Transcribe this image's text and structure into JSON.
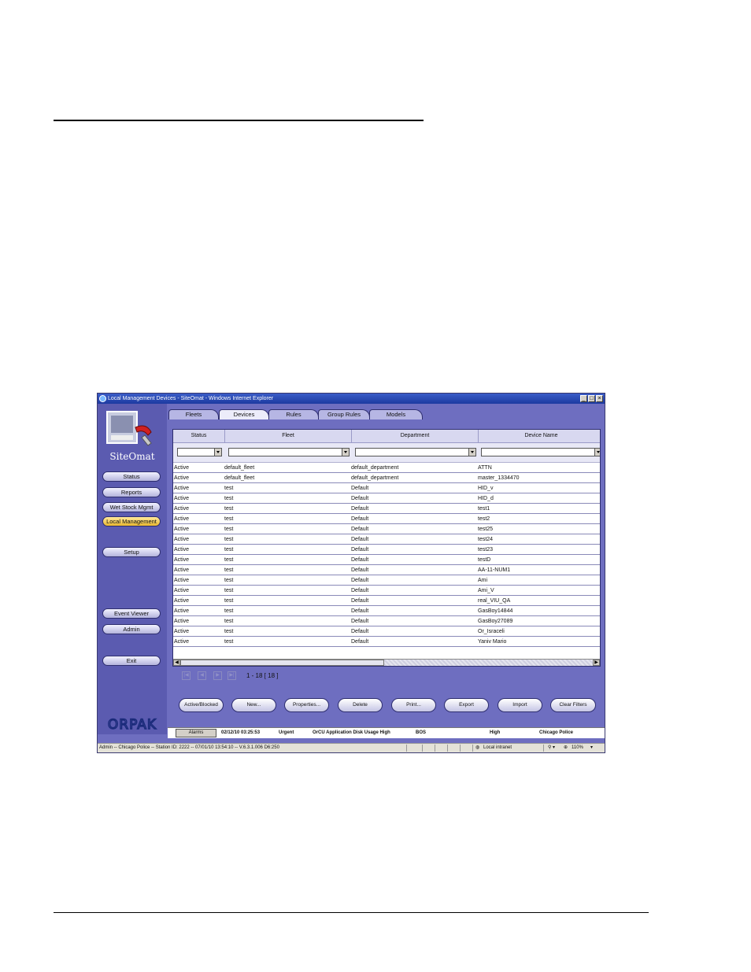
{
  "window": {
    "title": "Local Management Devices - SiteOmat - Windows Internet Explorer",
    "minimize": "_",
    "maximize": "□",
    "close": "×"
  },
  "sidebar": {
    "logo_text": "SiteOmat",
    "buttons": {
      "status": "Status",
      "reports": "Reports",
      "wet_stock": "Wet Stock Mgmt",
      "local_management": "Local Management",
      "setup": "Setup",
      "event_viewer": "Event Viewer",
      "admin": "Admin",
      "exit": "Exit"
    },
    "brand": "ORPAK"
  },
  "tabs": {
    "fleets": "Fleets",
    "devices": "Devices",
    "rules": "Rules",
    "group_rules": "Group Rules",
    "models": "Models"
  },
  "table": {
    "columns": [
      "Status",
      "Fleet",
      "Department",
      "Device Name"
    ],
    "rows": [
      [
        "Active",
        "default_fleet",
        "default_department",
        "ATTN"
      ],
      [
        "Active",
        "default_fleet",
        "default_department",
        "master_1334470"
      ],
      [
        "Active",
        "test",
        "Default",
        "HID_v"
      ],
      [
        "Active",
        "test",
        "Default",
        "HID_d"
      ],
      [
        "Active",
        "test",
        "Default",
        "test1"
      ],
      [
        "Active",
        "test",
        "Default",
        "test2"
      ],
      [
        "Active",
        "test",
        "Default",
        "test25"
      ],
      [
        "Active",
        "test",
        "Default",
        "test24"
      ],
      [
        "Active",
        "test",
        "Default",
        "test23"
      ],
      [
        "Active",
        "test",
        "Default",
        "testD"
      ],
      [
        "Active",
        "test",
        "Default",
        "AA-11-NUM1"
      ],
      [
        "Active",
        "test",
        "Default",
        "Ami"
      ],
      [
        "Active",
        "test",
        "Default",
        "Ami_V"
      ],
      [
        "Active",
        "test",
        "Default",
        "real_VIU_QA"
      ],
      [
        "Active",
        "test",
        "Default",
        "GasBoy14844"
      ],
      [
        "Active",
        "test",
        "Default",
        "GasBoy27089"
      ],
      [
        "Active",
        "test",
        "Default",
        "Or_Israceli"
      ],
      [
        "Active",
        "test",
        "Default",
        "Yaniv Mario"
      ]
    ]
  },
  "pager": {
    "first": "|◀",
    "prev": "◀",
    "next": "▶",
    "last": "▶|",
    "info": "1 - 18  [ 18 ]"
  },
  "actions": {
    "active_blocked": "Active/Blocked",
    "new": "New...",
    "properties": "Properties...",
    "delete": "Delete",
    "print": "Print...",
    "export": "Export",
    "import": "Import",
    "clear_filters": "Clear Filters"
  },
  "alarm_bar": {
    "button": "Alarms",
    "datetime": "02/12/10 03:25:53",
    "severity": "Urgent",
    "message": "OrCU Application Disk Usage High",
    "source": "BOS",
    "level": "High",
    "site": "Chicago Police"
  },
  "status_bar": {
    "text": "Admin -- Chicago Police -- Station ID: 2222 -- 07/01/10 13:54:10 -- V.6.3.1.006 D6:250",
    "zone": "Local intranet",
    "zoom": "110%"
  },
  "colors": {
    "sidebar": "#5b5bb0",
    "window_bg": "#6e6ec0",
    "active_nav": "#e8b830"
  }
}
